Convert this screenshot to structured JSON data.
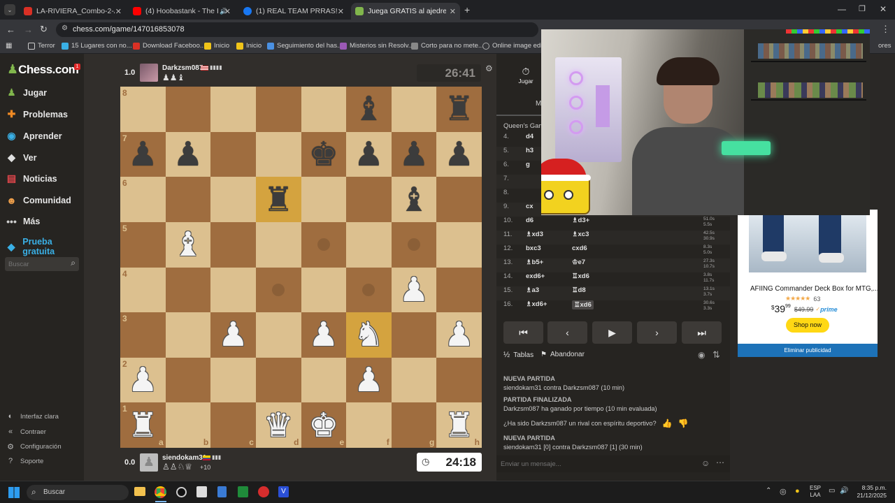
{
  "browser": {
    "tabs": [
      {
        "title": "LA-RIVIERA_Combo-2-Asados",
        "favcolor": "#d93025"
      },
      {
        "title": "(4) Hoobastank - The Reaso",
        "favcolor": "#ff0000"
      },
      {
        "title": "(1) REAL TEAM PRRAS! | Facebo",
        "favcolor": "#1877f2"
      },
      {
        "title": "Juega GRATIS al ajedrez online",
        "favcolor": "#81b64c"
      }
    ],
    "url": "chess.com/game/147016853078",
    "bookmarks": [
      "Terror",
      "15 Lugares con no...",
      "Download Faceboo...",
      "Inicio",
      "Inicio",
      "Seguimiento del has...",
      "Misterios sin Resolv...",
      "Corto para no mete...",
      "Online image editor",
      "ores"
    ]
  },
  "sidebar": {
    "logo": "Chess.com",
    "badge": "1",
    "items": [
      {
        "label": "Jugar",
        "icon": "pawn-icon",
        "color": "#81b64c"
      },
      {
        "label": "Problemas",
        "icon": "puzzle-icon",
        "color": "#f08a24"
      },
      {
        "label": "Aprender",
        "icon": "learn-icon",
        "color": "#3ab0e6"
      },
      {
        "label": "Ver",
        "icon": "watch-icon",
        "color": "#e0e0e0"
      },
      {
        "label": "Noticias",
        "icon": "news-icon",
        "color": "#e0464b"
      },
      {
        "label": "Comunidad",
        "icon": "community-icon",
        "color": "#f0a04b"
      },
      {
        "label": "Más",
        "icon": "more-icon",
        "color": "#cfcfcf"
      },
      {
        "label": "Prueba gratuita",
        "icon": "diamond-icon",
        "color": "#3ab0e6"
      }
    ],
    "search_placeholder": "Buscar",
    "bottom": [
      "Interfaz clara",
      "Contraer",
      "Configuración",
      "Soporte"
    ]
  },
  "game": {
    "top_player": {
      "score": "1.0",
      "name": "Darkzsm087",
      "captured": "♟♟♝",
      "time": "26:41"
    },
    "bottom_player": {
      "score": "0.0",
      "name": "siendokam31",
      "captured": "♙♙♘♕",
      "advantage": "+10",
      "time": "24:18"
    },
    "board": [
      [
        "",
        "",
        "",
        "",
        "",
        "bb",
        "",
        "br"
      ],
      [
        "bp",
        "bp",
        "",
        "",
        "bk",
        "bp",
        "bp",
        "bp"
      ],
      [
        "",
        "",
        "",
        "br",
        "",
        "",
        "bb",
        ""
      ],
      [
        "",
        "wb",
        "",
        "",
        "",
        "",
        "",
        ""
      ],
      [
        "",
        "",
        "",
        "",
        "",
        "",
        "wp",
        ""
      ],
      [
        "",
        "",
        "wp",
        "",
        "wp",
        "wn",
        "",
        "wp"
      ],
      [
        "wp",
        "",
        "",
        "",
        "",
        "wp",
        "",
        ""
      ],
      [
        "wr",
        "",
        "",
        "wq",
        "wk",
        "",
        "",
        "wr"
      ]
    ],
    "ranks": [
      "8",
      "7",
      "6",
      "5",
      "4",
      "3",
      "2",
      "1"
    ],
    "files": [
      "a",
      "b",
      "c",
      "d",
      "e",
      "f",
      "g",
      "h"
    ]
  },
  "panel": {
    "tab_label": "Jugar",
    "tab2_label": "M",
    "opening": "Queen's Gamb",
    "moves": [
      {
        "n": "4.",
        "w": "d4",
        "b": "",
        "t1": "",
        "t2": ""
      },
      {
        "n": "5.",
        "w": "h3",
        "b": "",
        "t1": "",
        "t2": ""
      },
      {
        "n": "6.",
        "w": "g",
        "b": "",
        "t1": "",
        "t2": ""
      },
      {
        "n": "7.",
        "w": "",
        "b": "",
        "t1": "",
        "t2": ""
      },
      {
        "n": "8.",
        "w": "",
        "b": "",
        "t1": "",
        "t2": ""
      },
      {
        "n": "9.",
        "w": "cx",
        "b": "",
        "t1": "",
        "t2": ""
      },
      {
        "n": "10.",
        "w": "d6",
        "b": "♗d3+",
        "t1": "51.0s",
        "t2": "5.5s"
      },
      {
        "n": "11.",
        "w": "♗xd3",
        "b": "♗xc3",
        "t1": "42.5s",
        "t2": "30.9s"
      },
      {
        "n": "12.",
        "w": "bxc3",
        "b": "cxd6",
        "t1": "8.3s",
        "t2": "5.0s"
      },
      {
        "n": "13.",
        "w": "♗b5+",
        "b": "♔e7",
        "t1": "27.3s",
        "t2": "10.7s"
      },
      {
        "n": "14.",
        "w": "exd6+",
        "b": "♖xd6",
        "t1": "3.8s",
        "t2": "11.7s"
      },
      {
        "n": "15.",
        "w": "♗a3",
        "b": "♖d8",
        "t1": "13.1s",
        "t2": "3.7s"
      },
      {
        "n": "16.",
        "w": "♗xd6+",
        "b": "♖xd6",
        "t1": "30.6s",
        "t2": "3.3s"
      }
    ],
    "draw_label": "Tablas",
    "resign_label": "Abandonar",
    "chat": [
      {
        "title": "NUEVA PARTIDA",
        "body": "siendokam31 contra Darkzsm087 (10 min)"
      },
      {
        "title": "PARTIDA FINALIZADA",
        "body": "Darkzsm087 ha ganado por tiempo (10 min evaluada)"
      },
      {
        "title": "",
        "body": "¿Ha sido Darkzsm087 un rival con espíritu deportivo?"
      },
      {
        "title": "NUEVA PARTIDA",
        "body": "siendokam31 [0] contra Darkzsm087 [1] (30 min)"
      }
    ],
    "chat_placeholder": "Enviar un mensaje..."
  },
  "ad": {
    "title": "AFIING Commander Deck Box for MTG,...",
    "rating_count": "63",
    "price_main": "39",
    "price_cents": "99",
    "price_old": "$49.99",
    "prime": "prime",
    "button": "Shop now",
    "remove": "Eliminar publicidad"
  },
  "taskbar": {
    "search": "Buscar",
    "lang": "ESP",
    "lang2": "LAA",
    "time": "8:35 p.m.",
    "date": "21/12/2025"
  }
}
